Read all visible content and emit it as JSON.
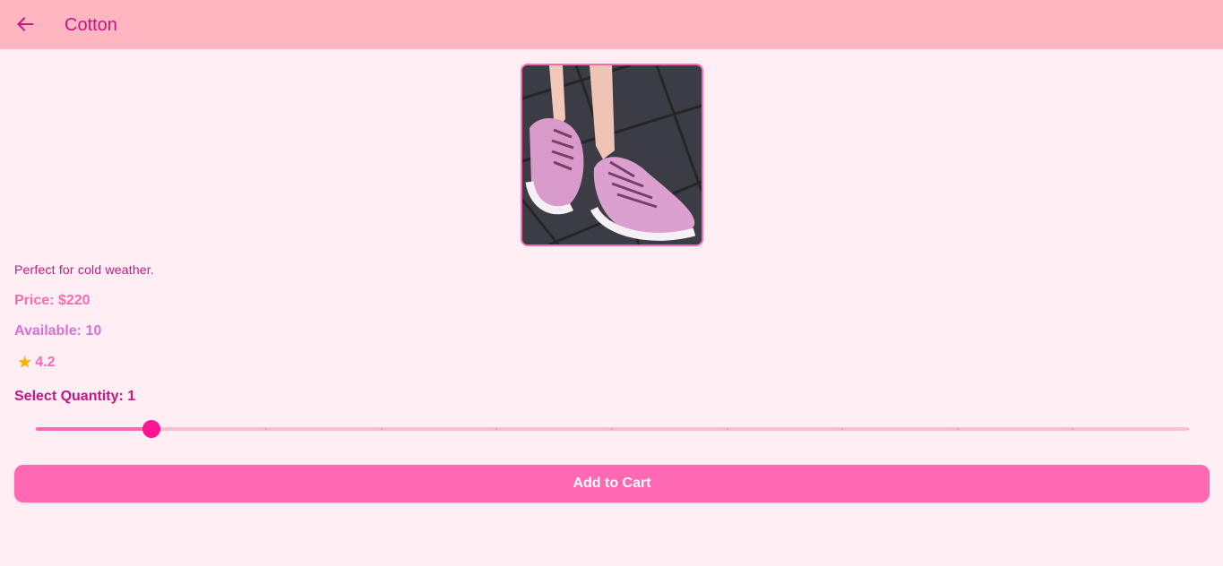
{
  "appbar": {
    "title": "Cotton",
    "back_icon": "arrow-left-icon"
  },
  "product": {
    "image_description": "pink knit sneakers on paving stones",
    "description": "Perfect for cold weather.",
    "price_text": "Price: $220",
    "available_text": "Available: 10",
    "rating_icon": "star-icon",
    "rating_value": "4.2"
  },
  "quantity": {
    "label": "Select Quantity: 1",
    "value": 1,
    "min": 0,
    "max": 10
  },
  "actions": {
    "add_to_cart_label": "Add to Cart"
  },
  "colors": {
    "appbar": "#ffb6c1",
    "background": "#ffeef4",
    "accent": "#ff69b4",
    "title": "#c71585",
    "thumb": "#ff1493",
    "available": "#da70d6"
  }
}
